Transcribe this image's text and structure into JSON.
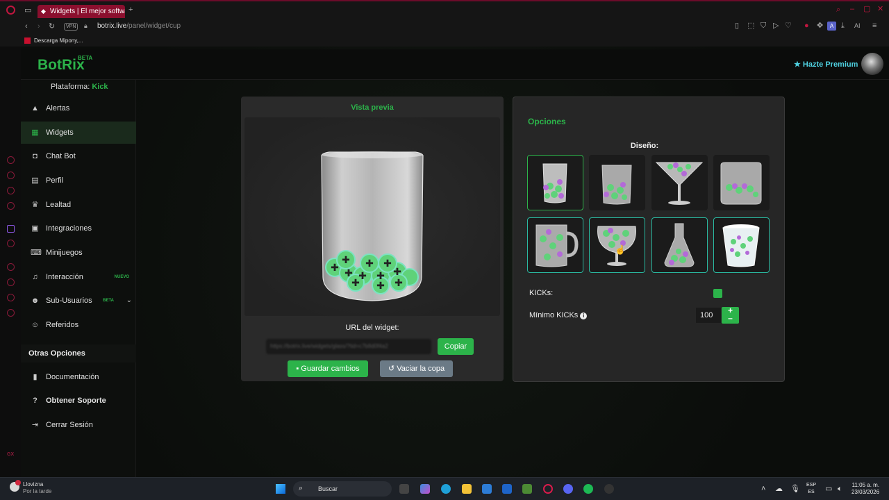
{
  "browser": {
    "tab_title": "Widgets | El mejor software",
    "url_host": "botrix.live",
    "url_path": "/panel/widget/cup",
    "vpn_label": "VPN",
    "bookmark": "Descarga Mipony,...",
    "ai_label": "AI"
  },
  "header": {
    "logo": "BotRix",
    "logo_badge": "BETA",
    "premium_label": "Hazte Premium"
  },
  "sidebar": {
    "platform_label": "Plataforma:",
    "platform_value": "Kick",
    "items": [
      {
        "label": "Alertas",
        "icon": "warning-icon"
      },
      {
        "label": "Widgets",
        "icon": "grid-icon"
      },
      {
        "label": "Chat Bot",
        "icon": "robot-icon"
      },
      {
        "label": "Perfil",
        "icon": "id-card-icon"
      },
      {
        "label": "Lealtad",
        "icon": "trophy-icon"
      },
      {
        "label": "Integraciones",
        "icon": "puzzle-icon"
      },
      {
        "label": "Minijuegos",
        "icon": "gamepad-icon"
      },
      {
        "label": "Interacción",
        "icon": "music-icon",
        "badge": "NUEVO"
      },
      {
        "label": "Sub-Usuarios",
        "icon": "users-icon",
        "badge": "BETA"
      },
      {
        "label": "Referidos",
        "icon": "people-icon"
      }
    ],
    "section_title": "Otras Opciones",
    "other_items": [
      {
        "label": "Documentación",
        "icon": "book-icon"
      },
      {
        "label": "Obtener Soporte",
        "icon": "help-icon"
      },
      {
        "label": "Cerrar Sesión",
        "icon": "logout-icon"
      }
    ],
    "accent_color": "#2cb34a"
  },
  "preview": {
    "title": "Vista previa",
    "url_label": "URL del widget:",
    "url_value": "https://botrix.live/widgets/glass/?tid=c7b8d0f4a2",
    "copy_label": "Copiar",
    "save_label": "Guardar cambios",
    "empty_label": "Vaciar la copa"
  },
  "options": {
    "title": "Opciones",
    "design_label": "Diseño:",
    "designs": [
      "glass-tall",
      "glass-short",
      "martini-glass",
      "glass-jar",
      "mug",
      "snifter",
      "flask",
      "plastic-cup"
    ],
    "selected_design": 0,
    "hovered_design": 5,
    "kicks_label": "KICKs:",
    "kicks_checked": true,
    "min_label": "Mínimo KICKs",
    "min_value": "100"
  },
  "taskbar": {
    "weather_title": "Llovizna",
    "weather_sub": "Por la tarde",
    "search_placeholder": "Buscar",
    "lang_top": "ESP",
    "lang_bottom": "ES",
    "time": "11:05 a. m.",
    "date": "23/03/2026"
  }
}
